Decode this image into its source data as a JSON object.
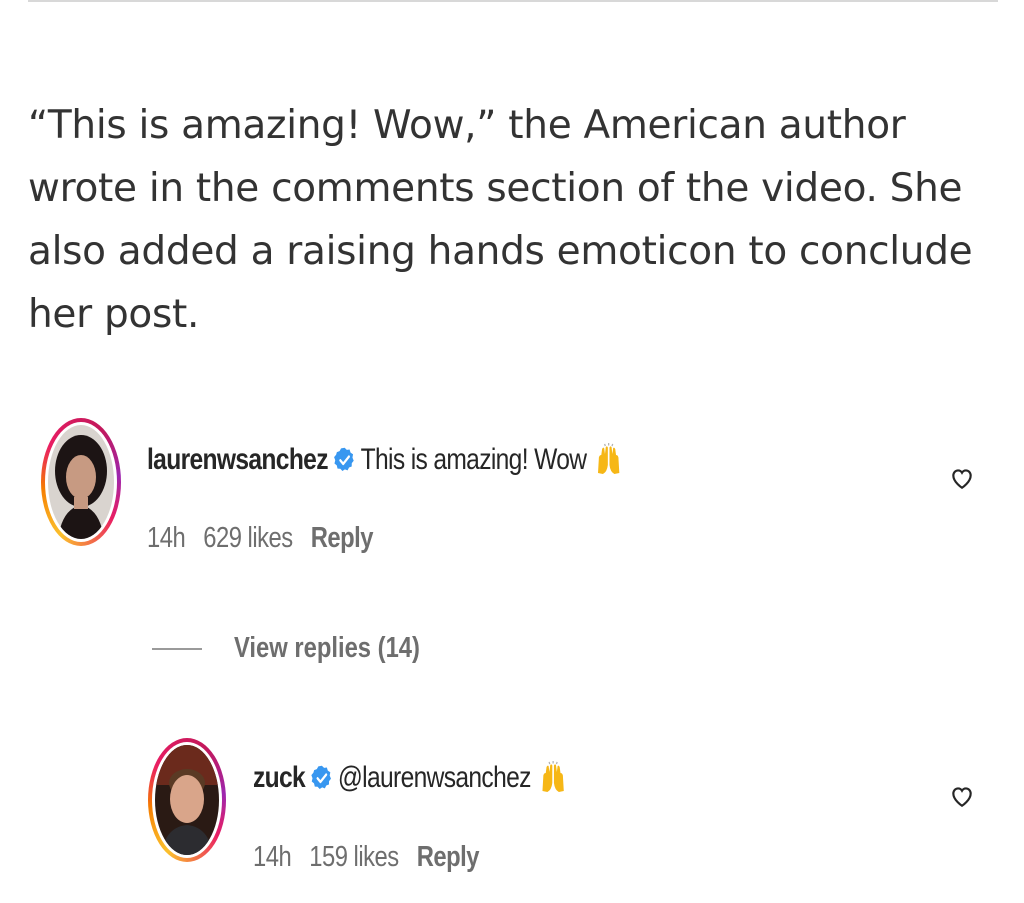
{
  "article": {
    "paragraph": "“This is amazing! Wow,” the American author wrote in the comments section of the video. She also added a raising hands emoticon to conclude her post."
  },
  "comments": [
    {
      "username": "laurenwsanchez",
      "verified": true,
      "text": "This is amazing! Wow",
      "emoji": "raising-hands-emoji",
      "time": "14h",
      "likes": "629 likes",
      "reply": "Reply"
    },
    {
      "username": "zuck",
      "verified": true,
      "text": "@laurenwsanchez",
      "emoji": "raising-hands-emoji",
      "time": "14h",
      "likes": "159 likes",
      "reply": "Reply"
    }
  ],
  "view_replies": "View replies (14)",
  "colors": {
    "verified_badge": "#3897f0",
    "text": "#262626",
    "meta": "#6e6e6e"
  }
}
